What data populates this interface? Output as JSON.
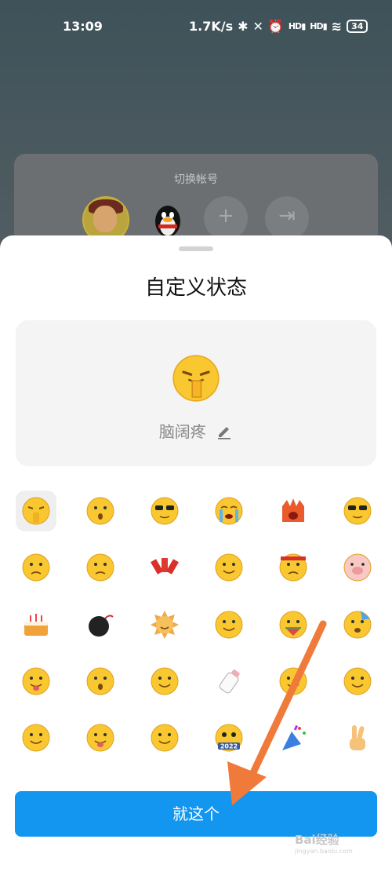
{
  "status_bar": {
    "time": "13:09",
    "net_speed": "1.7K/s",
    "signal_1": "HD",
    "signal_2": "HD",
    "battery": "34"
  },
  "account_switch": {
    "title": "切换帐号",
    "actions": [
      "add-account",
      "logout"
    ]
  },
  "sheet": {
    "title": "自定义状态",
    "preview": {
      "emoji": "facepalm-emoji",
      "label": "脑阔疼"
    },
    "emoji_grid": [
      {
        "name": "facepalm-emoji",
        "selected": true
      },
      {
        "name": "shocked-emoji"
      },
      {
        "name": "cool-glasses-emoji"
      },
      {
        "name": "crying-emoji"
      },
      {
        "name": "angry-fire-emoji"
      },
      {
        "name": "sunglasses-emoji"
      },
      {
        "name": "sad-emoji"
      },
      {
        "name": "eye-roll-emoji"
      },
      {
        "name": "firecracker-emoji"
      },
      {
        "name": "shush-emoji"
      },
      {
        "name": "headband-emoji"
      },
      {
        "name": "pig-emoji"
      },
      {
        "name": "cake-emoji"
      },
      {
        "name": "bomb-emoji"
      },
      {
        "name": "sun-emoji"
      },
      {
        "name": "wipe-sweat-emoji"
      },
      {
        "name": "eating-watermelon-emoji"
      },
      {
        "name": "party-hat-emoji"
      },
      {
        "name": "tongue-out-emoji"
      },
      {
        "name": "dizzy-emoji"
      },
      {
        "name": "struggle-emoji"
      },
      {
        "name": "baby-bottle-emoji"
      },
      {
        "name": "peek-emoji"
      },
      {
        "name": "old-man-emoji"
      },
      {
        "name": "side-peek-emoji"
      },
      {
        "name": "yummy-emoji"
      },
      {
        "name": "smile-emoji"
      },
      {
        "name": "2022-emoji"
      },
      {
        "name": "party-popper-emoji"
      },
      {
        "name": "victory-hand-emoji"
      }
    ],
    "badge_2022": "2022",
    "confirm_button": "就这个"
  },
  "watermark": {
    "text": "Bai经验",
    "sub": "jingyan.baidu.com"
  },
  "colors": {
    "accent": "#1296f0",
    "arrow": "#f07a3a",
    "emoji_yellow": "#f9c730"
  }
}
